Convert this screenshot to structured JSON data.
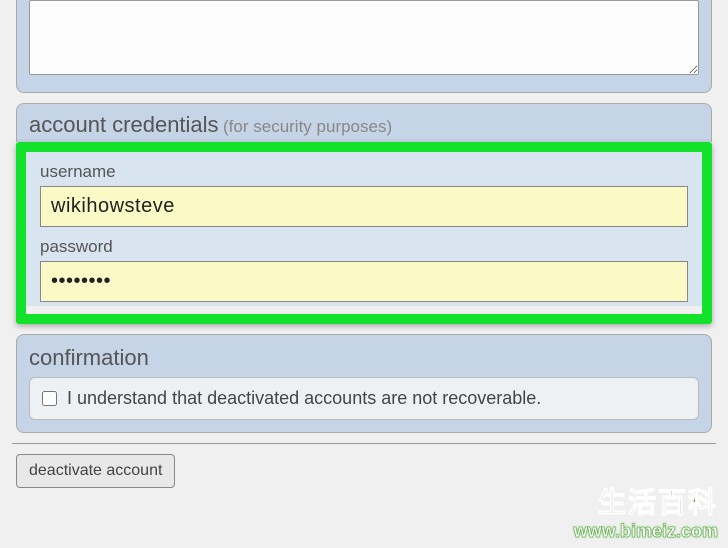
{
  "top_textarea": {
    "value": ""
  },
  "credentials": {
    "title": "account credentials",
    "subtitle": "(for security purposes)",
    "username_label": "username",
    "username_value": "wikihowsteve",
    "password_label": "password",
    "password_value": "••••••••"
  },
  "confirmation": {
    "title": "confirmation",
    "checkbox_checked": false,
    "text": "I understand that deactivated accounts are not recoverable."
  },
  "deactivate_label": "deactivate account",
  "watermark": {
    "brand": "生活百科",
    "url": "www.bimeiz.com"
  }
}
